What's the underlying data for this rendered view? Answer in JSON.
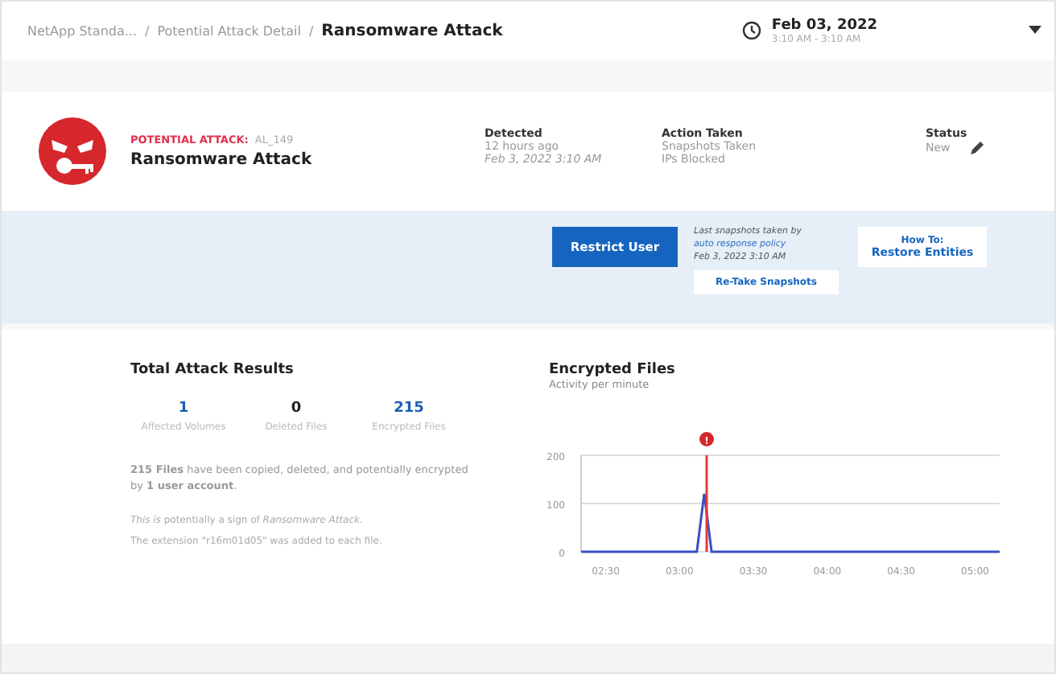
{
  "breadcrumb": [
    "NetApp Standa...",
    "Potential Attack Detail",
    "Ransomware Attack"
  ],
  "breadcrumb_separator": "/",
  "time_range": {
    "date": "Feb 03, 2022",
    "hours": "3:10 AM - 3:10 AM"
  },
  "alert": {
    "label": "POTENTIAL ATTACK:",
    "id": "AL_149",
    "title": "Ransomware Attack"
  },
  "facts": [
    {
      "label": "Detected",
      "lines": [
        "12 hours ago",
        "Feb 3, 2022 3:10 AM"
      ]
    },
    {
      "label": "Action Taken",
      "lines": [
        "Snapshots Taken",
        "IPs Blocked"
      ]
    },
    {
      "label": "Status",
      "lines": [
        "New"
      ]
    }
  ],
  "restrict_button": "Restrict User",
  "snapshot_note": {
    "text": "Last snapshots taken by",
    "link": "auto response policy",
    "date": "Feb 3, 2022 3:10 AM"
  },
  "retake_button": "Re-Take Snapshots",
  "restore_button": {
    "line1": "How To:",
    "line2": "Restore Entities"
  },
  "results": {
    "title": "Total Attack Results",
    "stats": [
      {
        "value": "1",
        "label": "Affected Volumes",
        "kind": "link"
      },
      {
        "value": "0",
        "label": "Deleted Files",
        "kind": "plain"
      },
      {
        "value": "215",
        "label": "Encrypted Files",
        "kind": "link"
      }
    ],
    "summary": "**215 Files** have been copied, deleted, and potentially encrypted by **1 user account**.",
    "note": "*This is* potentially a sign of *Ransomware Attack.*",
    "extension": "The extension \"r16m01d05\" was added to each file."
  },
  "chart": {
    "title": "Encrypted Files",
    "subtitle": "Activity per minute",
    "chart_data": {
      "type": "line",
      "x": [
        140,
        187,
        190,
        193,
        310
      ],
      "series": [
        {
          "color": "#3a4fc4",
          "values": [
            0,
            0,
            120,
            0,
            0
          ]
        }
      ],
      "xlim": [
        140,
        310
      ],
      "ylim": [
        0,
        200
      ],
      "yticks": [
        0,
        100,
        200
      ],
      "xticks": [
        {
          "value": 150,
          "label": "02:30"
        },
        {
          "value": 180,
          "label": "03:00"
        },
        {
          "value": 210,
          "label": "03:30"
        },
        {
          "value": 240,
          "label": "04:00"
        },
        {
          "value": 270,
          "label": "04:30"
        },
        {
          "value": 300,
          "label": "05:00"
        }
      ],
      "ref_lines": [
        {
          "axis": "x",
          "value": 191,
          "color": "#e03a3a"
        }
      ],
      "annotations": [
        "!"
      ]
    }
  }
}
